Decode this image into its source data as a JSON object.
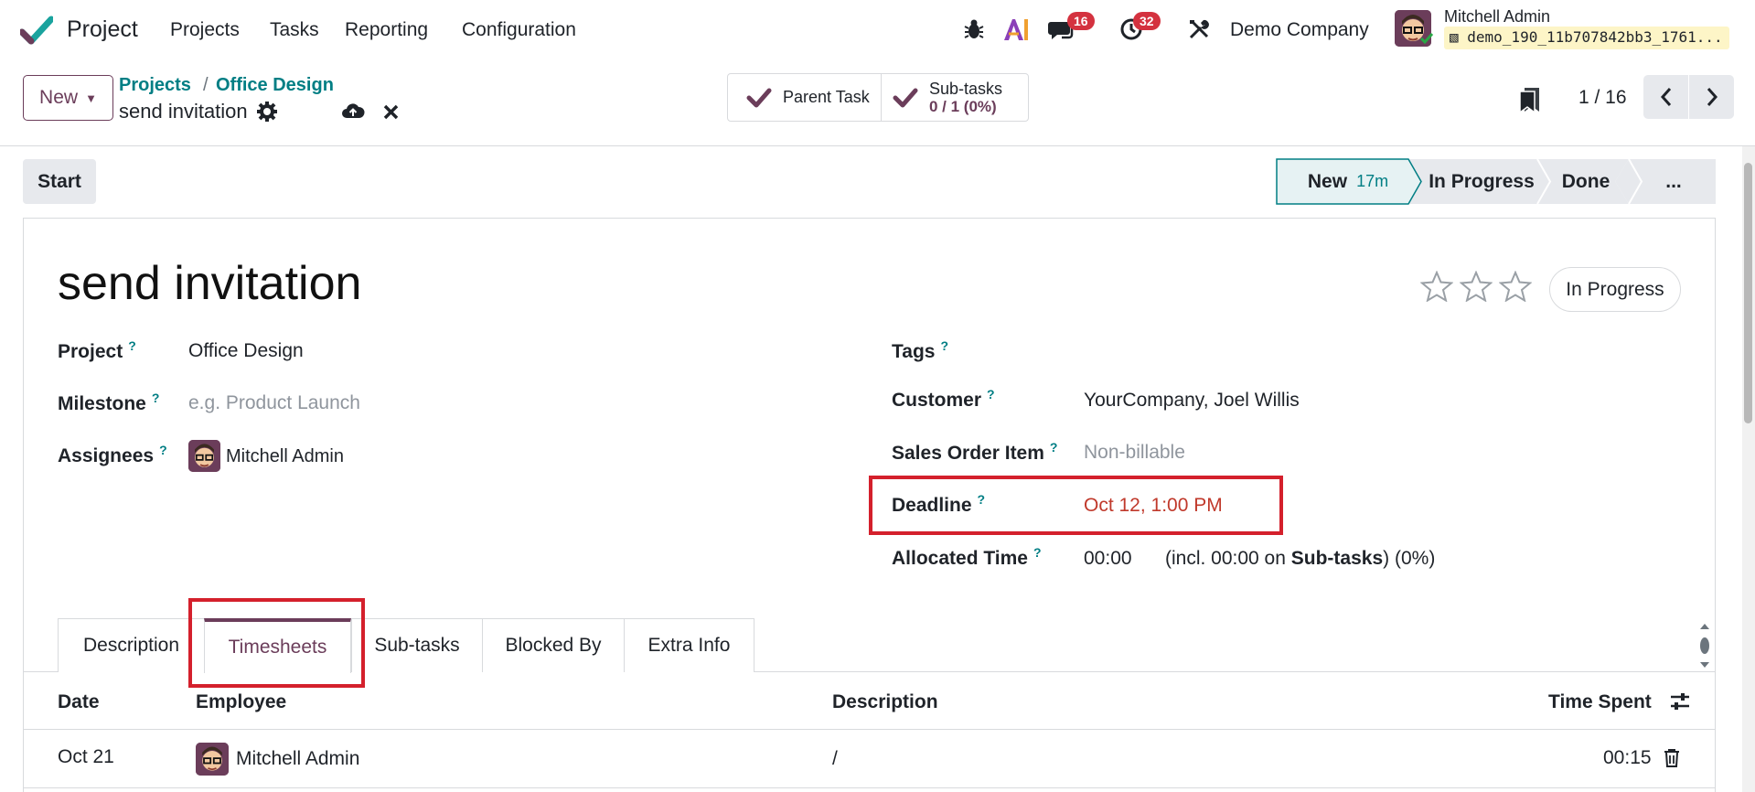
{
  "navbar": {
    "app_name": "Project",
    "menus": [
      "Projects",
      "Tasks",
      "Reporting",
      "Configuration"
    ],
    "messages_count": "16",
    "activities_count": "32",
    "company": "Demo Company",
    "user_name": "Mitchell Admin",
    "database": "demo_190_11b707842bb3_1761..."
  },
  "control": {
    "new_label": "New",
    "breadcrumb_root": "Projects",
    "breadcrumb_sep": "/",
    "breadcrumb_project": "Office Design",
    "record_name": "send invitation",
    "parent_task_label": "Parent Task",
    "subtasks_label": "Sub-tasks",
    "subtasks_value": "0 / 1 (0%)",
    "pager": "1 / 16"
  },
  "statusbar": {
    "start_label": "Start",
    "stages": [
      {
        "label": "New",
        "duration": "17m",
        "active": true
      },
      {
        "label": "In Progress",
        "active": false
      },
      {
        "label": "Done",
        "active": false
      },
      {
        "label": "...",
        "active": false
      }
    ]
  },
  "form": {
    "title": "send invitation",
    "state_button": "In Progress",
    "help_mark": "?",
    "left": {
      "project_label": "Project",
      "project_value": "Office Design",
      "milestone_label": "Milestone",
      "milestone_placeholder": "e.g. Product Launch",
      "assignees_label": "Assignees",
      "assignee_name": "Mitchell Admin"
    },
    "right": {
      "tags_label": "Tags",
      "customer_label": "Customer",
      "customer_value": "YourCompany, Joel Willis",
      "soi_label": "Sales Order Item",
      "soi_placeholder": "Non-billable",
      "deadline_label": "Deadline",
      "deadline_value": "Oct 12, 1:00 PM",
      "allocated_label": "Allocated Time",
      "allocated_value": "00:00",
      "allocated_incl_pre": "(incl. 00:00 on ",
      "allocated_incl_bold": "Sub-tasks",
      "allocated_incl_post": ") (0%)"
    }
  },
  "tabs": [
    "Description",
    "Timesheets",
    "Sub-tasks",
    "Blocked By",
    "Extra Info"
  ],
  "timesheet": {
    "headers": {
      "date": "Date",
      "employee": "Employee",
      "description": "Description",
      "time": "Time Spent"
    },
    "rows": [
      {
        "date": "Oct 21",
        "employee": "Mitchell Admin",
        "description": "/",
        "time": "00:15"
      }
    ]
  },
  "colors": {
    "brand": "#6b3d5a",
    "teal": "#017e84",
    "highlight": "#d4202c",
    "badge": "#d4323f"
  }
}
